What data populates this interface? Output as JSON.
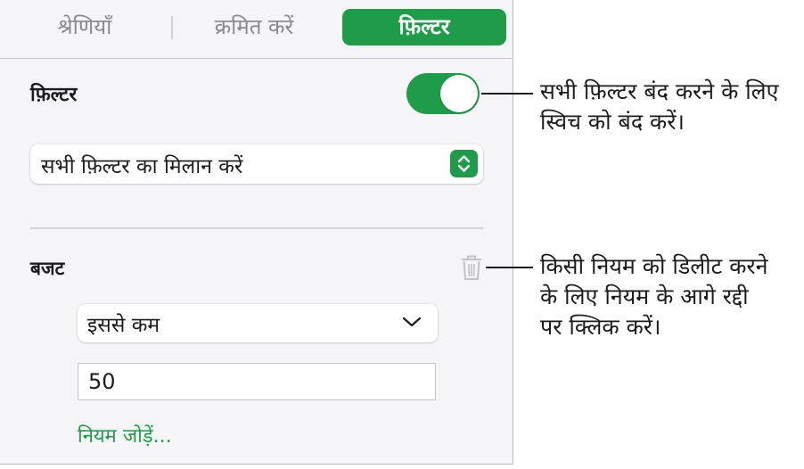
{
  "tabs": [
    {
      "label": "श्रेणियाँ",
      "active": false
    },
    {
      "label": "क्रमित करें",
      "active": false
    },
    {
      "label": "फ़िल्टर",
      "active": true
    }
  ],
  "filter_section": {
    "title": "फ़िल्टर",
    "toggle_on": true,
    "match_popup_value": "सभी फ़िल्टर का मिलान करें"
  },
  "rule": {
    "column_title": "बजट",
    "condition_value": "इससे कम",
    "value": "50"
  },
  "add_rule_link": "नियम जोड़ें...",
  "callouts": {
    "toggle": [
      "सभी फ़िल्टर बंद करने के लिए",
      "स्विच को बंद करें।"
    ],
    "trash": [
      "किसी नियम को डिलीट करने",
      "के लिए नियम के आगे रद्दी",
      "पर क्लिक करें।"
    ]
  },
  "colors": {
    "accent": "#1e9c4a",
    "panel_bg": "#f5f5f7"
  }
}
